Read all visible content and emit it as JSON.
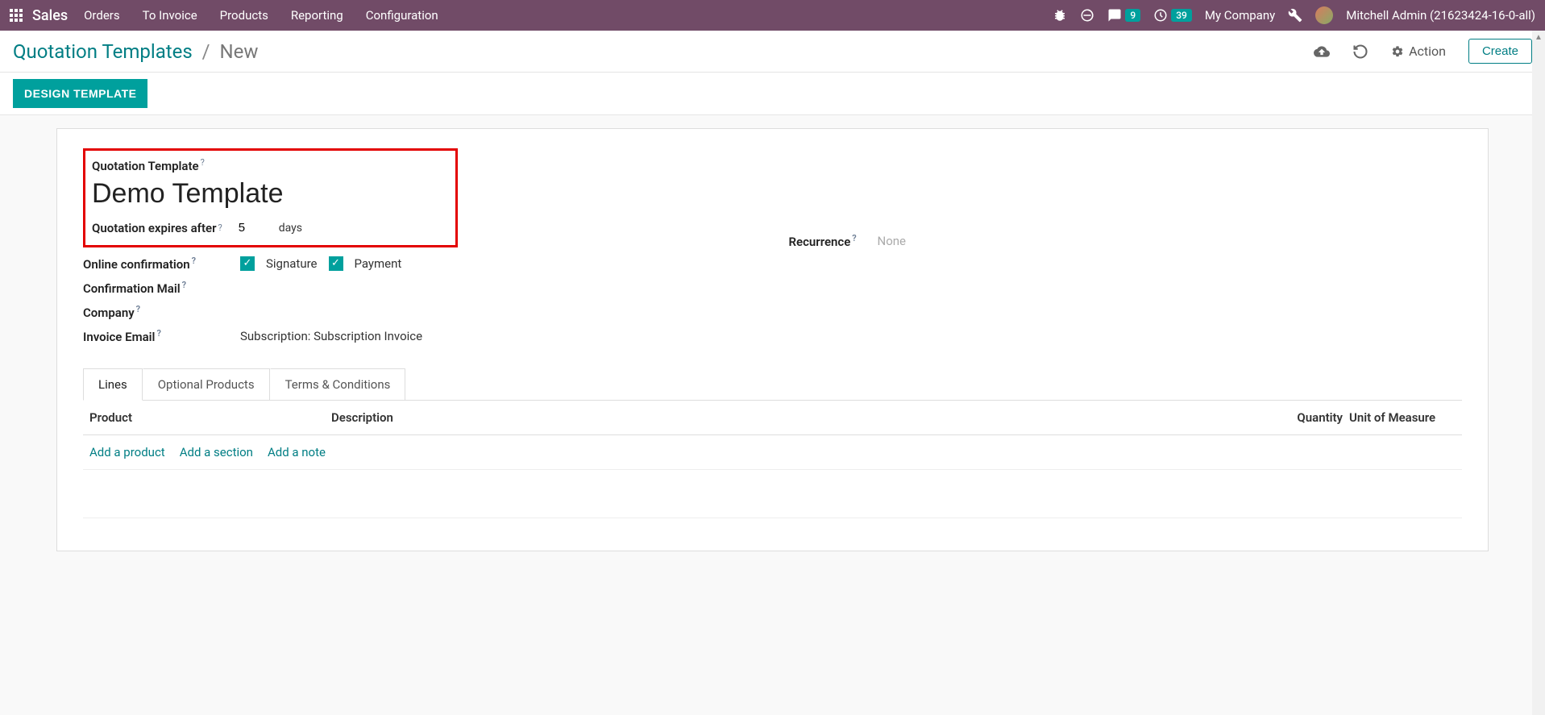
{
  "navbar": {
    "brand": "Sales",
    "menu": [
      "Orders",
      "To Invoice",
      "Products",
      "Reporting",
      "Configuration"
    ],
    "messages_badge": "9",
    "activities_badge": "39",
    "company": "My Company",
    "user": "Mitchell Admin (21623424-16-0-all)"
  },
  "breadcrumb": {
    "parent": "Quotation Templates",
    "current": "New"
  },
  "actionbar": {
    "action_label": "Action",
    "create_label": "Create"
  },
  "design_button": "DESIGN TEMPLATE",
  "form": {
    "template_label": "Quotation Template",
    "template_name": "Demo Template",
    "expires_label": "Quotation expires after",
    "expires_value": "5",
    "expires_suffix": "days",
    "recurrence_label": "Recurrence",
    "recurrence_value": "None",
    "online_conf_label": "Online confirmation",
    "signature_label": "Signature",
    "payment_label": "Payment",
    "conf_mail_label": "Confirmation Mail",
    "company_label": "Company",
    "invoice_email_label": "Invoice Email",
    "invoice_email_value": "Subscription: Subscription Invoice"
  },
  "tabs": [
    "Lines",
    "Optional Products",
    "Terms & Conditions"
  ],
  "table": {
    "headers": {
      "product": "Product",
      "description": "Description",
      "quantity": "Quantity",
      "uom": "Unit of Measure"
    },
    "actions": {
      "add_product": "Add a product",
      "add_section": "Add a section",
      "add_note": "Add a note"
    }
  }
}
